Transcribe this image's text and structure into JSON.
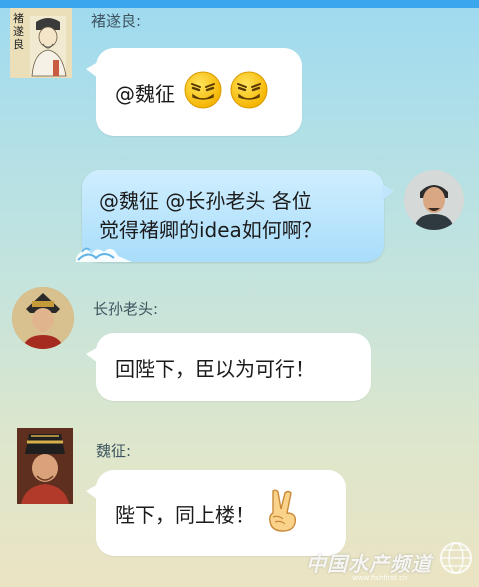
{
  "messages": [
    {
      "sender": "褚遂良:",
      "text": "@魏征",
      "emojis": [
        "smirk-emoji",
        "smirk-emoji"
      ]
    },
    {
      "sender_self": true,
      "line1": "@魏征 @长孙老头 各位",
      "line2": "觉得褚卿的idea如何啊？"
    },
    {
      "sender": "长孙老头:",
      "text": "回陛下，臣以为可行！"
    },
    {
      "sender": "魏征:",
      "text": "陛下，同上楼！",
      "emojis": [
        "victory-hand-emoji"
      ]
    }
  ],
  "avatars": {
    "chu_suiliang_text": "褚遂良"
  },
  "watermark": {
    "text": "中国水产频道",
    "url": "www.fishfirst.cn"
  },
  "colors": {
    "topbar": "#39a6ee",
    "bubble_other": "#ffffff",
    "bubble_self": "#a9ddfb"
  }
}
